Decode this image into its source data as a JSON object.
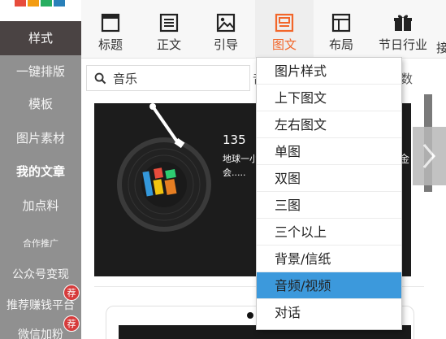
{
  "sidebar": {
    "items": [
      {
        "label": "样式"
      },
      {
        "label": "一键排版"
      },
      {
        "label": "模板"
      },
      {
        "label": "图片素材"
      },
      {
        "label": "我的文章"
      },
      {
        "label": "加点料"
      },
      {
        "label": "合作推广"
      },
      {
        "label": "公众号变现"
      },
      {
        "label": "推荐赚钱平台"
      },
      {
        "label": "微信加粉"
      }
    ],
    "badge_text": "荐"
  },
  "toolbar": {
    "items": [
      {
        "label": "标题",
        "icon": "title-icon"
      },
      {
        "label": "正文",
        "icon": "text-icon"
      },
      {
        "label": "引导",
        "icon": "image-guide-icon"
      },
      {
        "label": "图文",
        "icon": "image-text-icon"
      },
      {
        "label": "布局",
        "icon": "layout-icon"
      },
      {
        "label": "节日行业",
        "icon": "gift-icon"
      }
    ],
    "active_label": "图文",
    "cut_label": "接",
    "active_color": "#f2662a"
  },
  "search": {
    "value": "音乐",
    "placeholder": ""
  },
  "behind_text": {
    "left_cut": "音",
    "right_cut": "数"
  },
  "card": {
    "title": "135",
    "desc": "地球一小会.....",
    "tail": "金"
  },
  "dropdown": {
    "items": [
      "图片样式",
      "上下图文",
      "左右图文",
      "单图",
      "双图",
      "三图",
      "三个以上",
      "背景/信纸",
      "音频/视频",
      "对话"
    ],
    "active_index": 8,
    "highlight_color": "#3c99dc"
  }
}
